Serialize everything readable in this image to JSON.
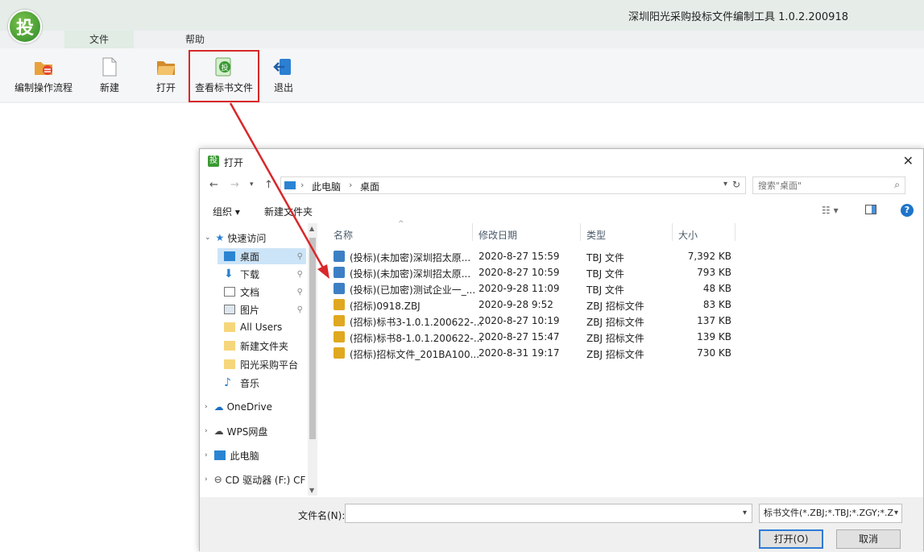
{
  "app": {
    "title": "深圳阳光采购投标文件编制工具 1.0.2.200918",
    "logo_text": "投",
    "menu": [
      "文件",
      "帮助"
    ],
    "ribbon": [
      "编制操作流程",
      "新建",
      "打开",
      "查看标书文件",
      "退出"
    ]
  },
  "dialog": {
    "title": "打开",
    "icon_text": "投",
    "close": "✕",
    "breadcrumb": [
      "此电脑",
      "桌面"
    ],
    "search_placeholder": "搜索\"桌面\"",
    "toolbar": {
      "organize": "组织 ▾",
      "new_folder": "新建文件夹"
    },
    "nav": {
      "quick_access": "快速访问",
      "items": [
        "桌面",
        "下载",
        "文档",
        "图片",
        "All Users",
        "新建文件夹",
        "阳光采购平台",
        "音乐"
      ],
      "onedrive": "OneDrive",
      "wps": "WPS网盘",
      "this_pc": "此电脑",
      "cd": "CD 驱动器 (F:) CF"
    },
    "columns": {
      "name": "名称",
      "date": "修改日期",
      "type": "类型",
      "size": "大小"
    },
    "files": [
      {
        "name": "(投标)(未加密)深圳招太原...",
        "date": "2020-8-27 15:59",
        "type": "TBJ 文件",
        "size": "7,392 KB",
        "kind": "tbj"
      },
      {
        "name": "(投标)(未加密)深圳招太原...",
        "date": "2020-8-27 10:59",
        "type": "TBJ 文件",
        "size": "793 KB",
        "kind": "tbj"
      },
      {
        "name": "(投标)(已加密)测试企业一_...",
        "date": "2020-9-28 11:09",
        "type": "TBJ 文件",
        "size": "48 KB",
        "kind": "tbj"
      },
      {
        "name": "(招标)0918.ZBJ",
        "date": "2020-9-28 9:52",
        "type": "ZBJ 招标文件",
        "size": "83 KB",
        "kind": "zbj"
      },
      {
        "name": "(招标)标书3-1.0.1.200622-...",
        "date": "2020-8-27 10:19",
        "type": "ZBJ 招标文件",
        "size": "137 KB",
        "kind": "zbj"
      },
      {
        "name": "(招标)标书8-1.0.1.200622-...",
        "date": "2020-8-27 15:47",
        "type": "ZBJ 招标文件",
        "size": "139 KB",
        "kind": "zbj"
      },
      {
        "name": "(招标)招标文件_201BA100...",
        "date": "2020-8-31 19:17",
        "type": "ZBJ 招标文件",
        "size": "730 KB",
        "kind": "zbj"
      }
    ],
    "filename_label": "文件名(N):",
    "filename_value": "",
    "filter": "标书文件(*.ZBJ;*.TBJ;*.ZGY;*.Z",
    "open_button": "打开(O)",
    "cancel_button": "取消"
  },
  "colors": {
    "highlight": "#d8282a",
    "accent": "#2e7bd5",
    "tbj_icon": "#3d7fc4",
    "zbj_icon": "#e0a820"
  }
}
